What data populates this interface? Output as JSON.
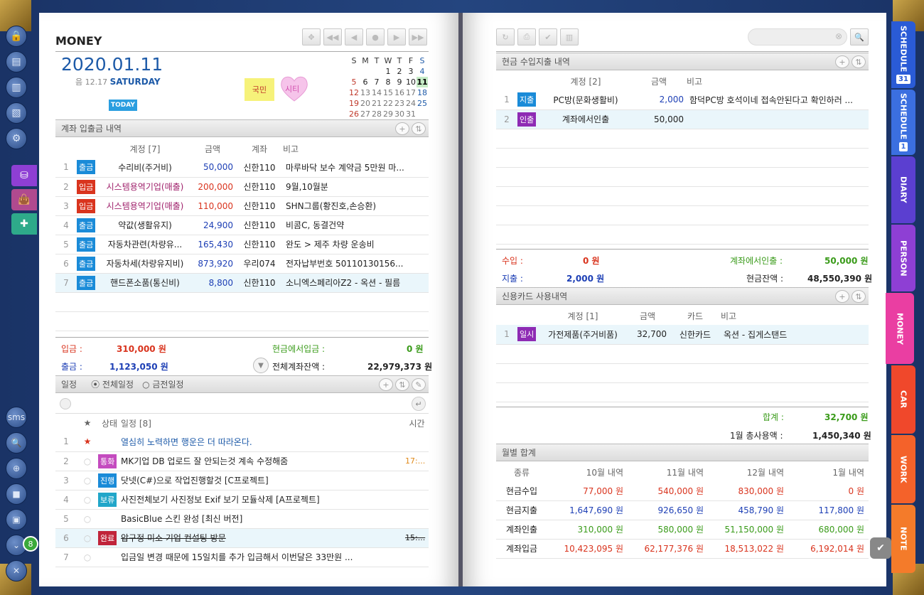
{
  "title": "MONEY",
  "date": {
    "main": "2020.01.11",
    "lunar_prefix": "음",
    "lunar": "12.17",
    "weekday": "SATURDAY",
    "today": "TODAY"
  },
  "notes": {
    "note1": "국민",
    "note2": "시티"
  },
  "calendar": {
    "header": [
      "S",
      "M",
      "T",
      "W",
      "T",
      "F",
      "S"
    ],
    "rows": [
      [
        "",
        "",
        "",
        "1",
        "2",
        "3",
        "4"
      ],
      [
        "5",
        "6",
        "7",
        "8",
        "9",
        "10",
        "11"
      ],
      [
        "12",
        "13",
        "14",
        "15",
        "16",
        "17",
        "18"
      ],
      [
        "19",
        "20",
        "21",
        "22",
        "23",
        "24",
        "25"
      ],
      [
        "26",
        "27",
        "28",
        "29",
        "30",
        "31",
        ""
      ]
    ]
  },
  "account": {
    "header": "계좌 입출금 내역",
    "cols": [
      "계정 [7]",
      "금액",
      "계좌",
      "비고"
    ],
    "rows": [
      {
        "n": "1",
        "type": "출금",
        "color": "#1a8bd8",
        "item": "수리비(주거비)",
        "amount": "50,000",
        "acct": "신한110",
        "memo": "마루바닥 보수 계약금 5만원 마..."
      },
      {
        "n": "2",
        "type": "입금",
        "color": "#d9341e",
        "item": "시스템용역기업(매출)",
        "amount": "200,000",
        "acct": "신한110",
        "memo": "9월,10월분"
      },
      {
        "n": "3",
        "type": "입금",
        "color": "#d9341e",
        "item": "시스템용역기업(매출)",
        "amount": "110,000",
        "acct": "신한110",
        "memo": "SHN그룹(황진호,손승환)"
      },
      {
        "n": "4",
        "type": "출금",
        "color": "#1a8bd8",
        "item": "약값(생활유지)",
        "amount": "24,900",
        "acct": "신한110",
        "memo": "비콤C, 동결건약"
      },
      {
        "n": "5",
        "type": "출금",
        "color": "#1a8bd8",
        "item": "자동차관련(차량유...",
        "amount": "165,430",
        "acct": "신한110",
        "memo": "완도 > 제주 차량 운송비"
      },
      {
        "n": "6",
        "type": "출금",
        "color": "#1a8bd8",
        "item": "자동차세(차량유지비)",
        "amount": "873,920",
        "acct": "우리074",
        "memo": "전자납부번호 50110130156..."
      },
      {
        "n": "7",
        "type": "출금",
        "color": "#1a8bd8",
        "item": "핸드폰소품(통신비)",
        "amount": "8,800",
        "acct": "신한110",
        "memo": "소니엑스페리아Z2 - 옥션 - 필름"
      }
    ],
    "in_label": "입금 :",
    "in_value": "310,000 원",
    "cashin_label": "현금에서입금 :",
    "cashin_value": "0 원",
    "out_label": "출금 :",
    "out_value": "1,123,050 원",
    "total_label": "전체계좌잔액 :",
    "total_value": "22,979,373 원"
  },
  "schedule": {
    "header": "일정",
    "opt1": "전체일정",
    "opt2": "금전일정",
    "cols": [
      "★",
      "상태",
      "일정 [8]",
      "시간"
    ],
    "rows": [
      {
        "n": "1",
        "status": "",
        "color": "",
        "text": "열심히 노력하면 행운은 더 따라온다.",
        "time": "",
        "blue": true
      },
      {
        "n": "2",
        "status": "통화",
        "color": "#c44bbf",
        "text": "MK기업 DB 업로드 잘 안되는것 계속 수정해줌",
        "time": "17:...",
        "blue": false
      },
      {
        "n": "3",
        "status": "진행",
        "color": "#1a8bd8",
        "text": "닷넷(C#)으로 작업진행할것 [C프로젝트]",
        "time": "",
        "blue": false
      },
      {
        "n": "4",
        "status": "보류",
        "color": "#21a6c9",
        "text": "사진전체보기 사진정보 Exif 보기 모듈삭제 [A프로젝트]",
        "time": "",
        "blue": false
      },
      {
        "n": "5",
        "status": "",
        "color": "",
        "text": "BasicBlue 스킨 완성 [최신 버전]",
        "time": "",
        "blue": false
      },
      {
        "n": "6",
        "status": "완료",
        "color": "#c0243a",
        "text": "압구정 미소 기업 컨설팅 방문",
        "time": "15:...",
        "blue": false
      },
      {
        "n": "7",
        "status": "",
        "color": "",
        "text": "입금일 변경 때문에 15일치를 추가 입금해서 이번달은 33만원 ...",
        "time": "",
        "blue": false
      }
    ]
  },
  "cash": {
    "header": "현금 수입지출 내역",
    "cols": [
      "계정 [2]",
      "금액",
      "비고"
    ],
    "rows": [
      {
        "n": "1",
        "type": "지출",
        "color": "#1a8bd8",
        "item": "PC방(문화생활비)",
        "amount": "2,000",
        "memo": "함덕PC방 호석이네 접속안된다고 확인하러 ..."
      },
      {
        "n": "2",
        "type": "인출",
        "color": "#8e2bb4",
        "item": "계좌에서인출",
        "amount": "50,000",
        "memo": ""
      }
    ],
    "in_label": "수입 :",
    "in_value": "0 원",
    "wd_label": "계좌에서인출 :",
    "wd_value": "50,000 원",
    "out_label": "지출 :",
    "out_value": "2,000 원",
    "bal_label": "현금잔액 :",
    "bal_value": "48,550,390 원"
  },
  "card": {
    "header": "신용카드 사용내역",
    "cols": [
      "계정 [1]",
      "금액",
      "카드",
      "비고"
    ],
    "rows": [
      {
        "n": "1",
        "type": "일시",
        "color": "#8e2bb4",
        "item": "가전제품(주거비품)",
        "amount": "32,700",
        "card": "신한카드",
        "memo": "옥션 - 집게스탠드"
      }
    ],
    "sum_label": "합계 :",
    "sum_value": "32,700 원",
    "month_label": "1월 총사용액 :",
    "month_value": "1,450,340 원"
  },
  "monthly": {
    "header": "월별 합계",
    "cols": [
      "종류",
      "10월 내역",
      "11월 내역",
      "12월 내역",
      "1월 내역"
    ],
    "rows": [
      {
        "label": "현금수입",
        "color": "#d9341e",
        "v": [
          "77,000 원",
          "540,000 원",
          "830,000 원",
          "0 원"
        ]
      },
      {
        "label": "현금지출",
        "color": "#1d3fb5",
        "v": [
          "1,647,690 원",
          "926,650 원",
          "458,790 원",
          "117,800 원"
        ]
      },
      {
        "label": "계좌인출",
        "color": "#3a9b1a",
        "v": [
          "310,000 원",
          "580,000 원",
          "51,150,000 원",
          "680,000 원"
        ]
      },
      {
        "label": "계좌입금",
        "color": "#d9341e",
        "v": [
          "10,423,095 원",
          "62,177,376 원",
          "18,513,022 원",
          "6,192,014 원"
        ]
      }
    ]
  },
  "tabs": [
    {
      "label": "SCHEDULE",
      "badge": "31",
      "color": "#2a5bd6"
    },
    {
      "label": "SCHEDULE",
      "badge": "1",
      "color": "#3b6fe0"
    },
    {
      "label": "DIARY",
      "color": "#5b3fd0"
    },
    {
      "label": "PERSON",
      "color": "#8e3fd4"
    },
    {
      "label": "MONEY",
      "color": "#ea3ea2"
    },
    {
      "label": "CAR",
      "color": "#f0482b"
    },
    {
      "label": "WORK",
      "color": "#f4622a"
    },
    {
      "label": "NOTE",
      "color": "#f47b2a"
    }
  ],
  "left_badge": "8",
  "sms": "sms"
}
